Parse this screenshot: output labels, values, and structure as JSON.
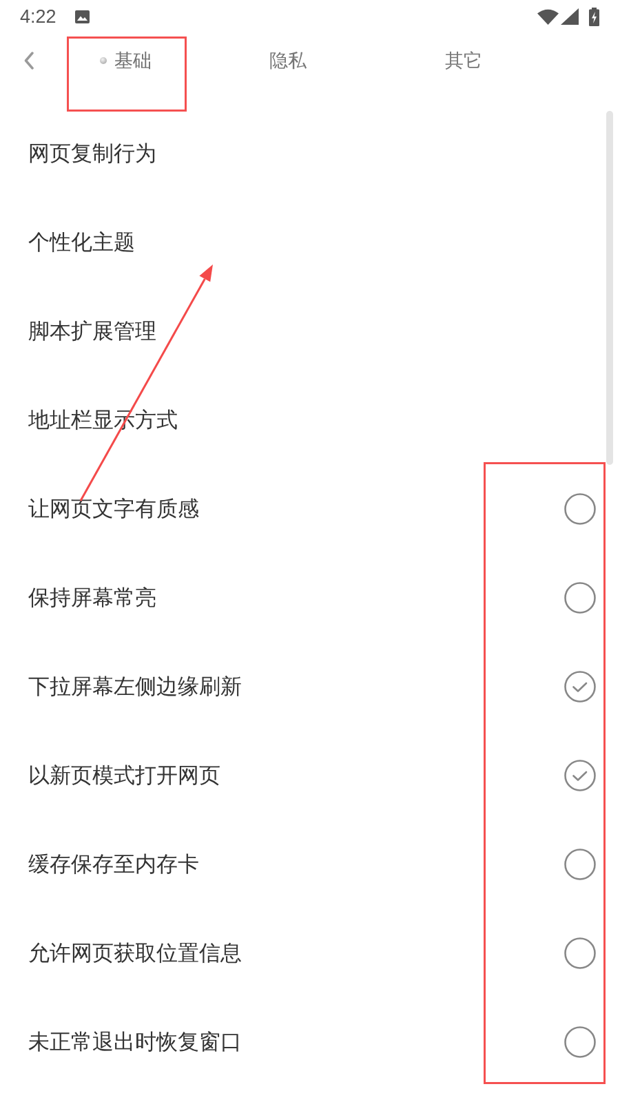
{
  "status_bar": {
    "time": "4:22"
  },
  "tabs": [
    {
      "label": "基础",
      "selected": true
    },
    {
      "label": "隐私",
      "selected": false
    },
    {
      "label": "其它",
      "selected": false
    }
  ],
  "items": [
    {
      "kind": "entry",
      "label": "网页复制行为"
    },
    {
      "kind": "entry",
      "label": "个性化主题"
    },
    {
      "kind": "entry",
      "label": "脚本扩展管理"
    },
    {
      "kind": "entry",
      "label": "地址栏显示方式"
    },
    {
      "kind": "checkbox",
      "label": "让网页文字有质感",
      "checked": false
    },
    {
      "kind": "checkbox",
      "label": "保持屏幕常亮",
      "checked": false
    },
    {
      "kind": "checkbox",
      "label": "下拉屏幕左侧边缘刷新",
      "checked": true
    },
    {
      "kind": "checkbox",
      "label": "以新页模式打开网页",
      "checked": true
    },
    {
      "kind": "checkbox",
      "label": "缓存保存至内存卡",
      "checked": false
    },
    {
      "kind": "checkbox",
      "label": "允许网页获取位置信息",
      "checked": false
    },
    {
      "kind": "checkbox",
      "label": "未正常退出时恢复窗口",
      "checked": false
    }
  ]
}
